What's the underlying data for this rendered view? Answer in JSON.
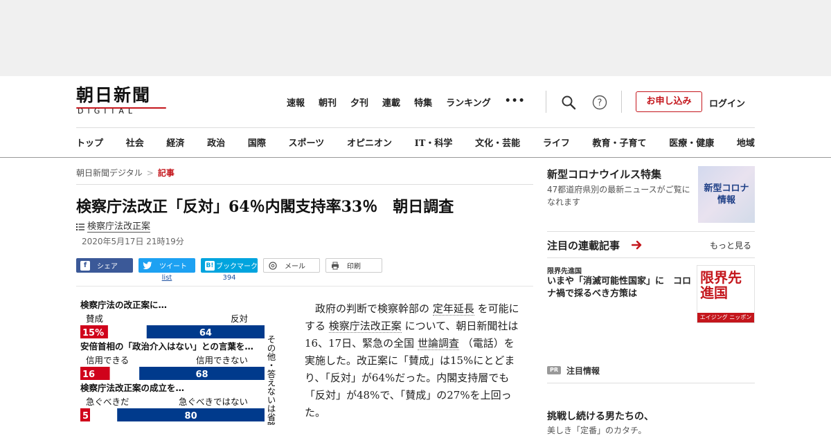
{
  "header": {
    "logo_main": "朝日新聞",
    "logo_sub": "DIGITAL",
    "nav": [
      "速報",
      "朝刊",
      "夕刊",
      "連載",
      "特集",
      "ランキング",
      "•••"
    ],
    "apply_label": "お申し込み",
    "login_label": "ログイン"
  },
  "categories": [
    "トップ",
    "社会",
    "経済",
    "政治",
    "国際",
    "スポーツ",
    "オピニオン",
    "IT・科学",
    "文化・芸能",
    "ライフ",
    "教育・子育て",
    "医療・健康",
    "地域"
  ],
  "breadcrumb": {
    "home": "朝日新聞デジタル",
    "separator": ">",
    "current": "記事"
  },
  "article": {
    "title": "検察庁法改正「反対」64％内閣支持率33％　朝日調査",
    "tag": "検察庁法改正案",
    "date": "2020年5月17日 21時19分",
    "share": {
      "facebook": "シェア",
      "twitter": "ツイート",
      "hatena": "ブックマーク",
      "mail": "メール",
      "print": "印刷",
      "twitter_count": "list",
      "hatena_count": "394"
    },
    "body": {
      "p1": "政府の判断で検察幹部の",
      "link1": "定年延長",
      "p2": "を可能にする",
      "link2": "検察庁法改正案",
      "p3": "について、朝日新聞社は16、17日、緊急の全国",
      "link3": "世論調査",
      "p4": "（電話）を実施した。改正案に「賛成」は15%にとどまり、「反対」が64%だった。内閣支持層でも「反対」が48%で、「賛成」の27%を上回った。"
    }
  },
  "chart_data": {
    "type": "bar",
    "side_note": "その他・答えないは省略",
    "questions": [
      {
        "question": "検察庁法の改正案に…",
        "left_label": "賛成",
        "right_label": "反対",
        "left_value": 15,
        "right_value": 64,
        "left_text": "15%",
        "right_text": "64"
      },
      {
        "question": "安倍首相の「政治介入はない」との言葉を…",
        "left_label": "信用できる",
        "right_label": "信用できない",
        "left_value": 16,
        "right_value": 68,
        "left_text": "16",
        "right_text": "68"
      },
      {
        "question": "検察庁法改正案の成立を…",
        "left_label": "急ぐべきだ",
        "right_label": "急ぐべきではない",
        "left_value": 5,
        "right_value": 80,
        "left_text": "5",
        "right_text": "80"
      }
    ],
    "colors": {
      "left": "#d0021b",
      "right": "#003a8c"
    }
  },
  "sidebar": {
    "corona_title": "新型コロナウイルス特集",
    "corona_desc": "47都道府県別の最新ニュースがご覧になれます",
    "corona_thumb": "新型コロナ情報",
    "serial_heading": "注目の連載記事",
    "more_label": "もっと見る",
    "serial_category": "限界先進国",
    "serial_title": "いまや「消滅可能性国家」に　コロナ禍で採るべき方策は",
    "genkai_big": "限界先進国",
    "genkai_band": "エイジング ニッポン",
    "pr_badge": "PR",
    "pr_label": "注目情報",
    "pr_title": "挑戦し続ける男たちの、",
    "pr_sub": "美しき「定番」のカタチ。"
  },
  "colors": {
    "brand": "#c4161c",
    "facebook": "#3b5998",
    "twitter": "#1da1f2",
    "hatena": "#00a4de"
  }
}
